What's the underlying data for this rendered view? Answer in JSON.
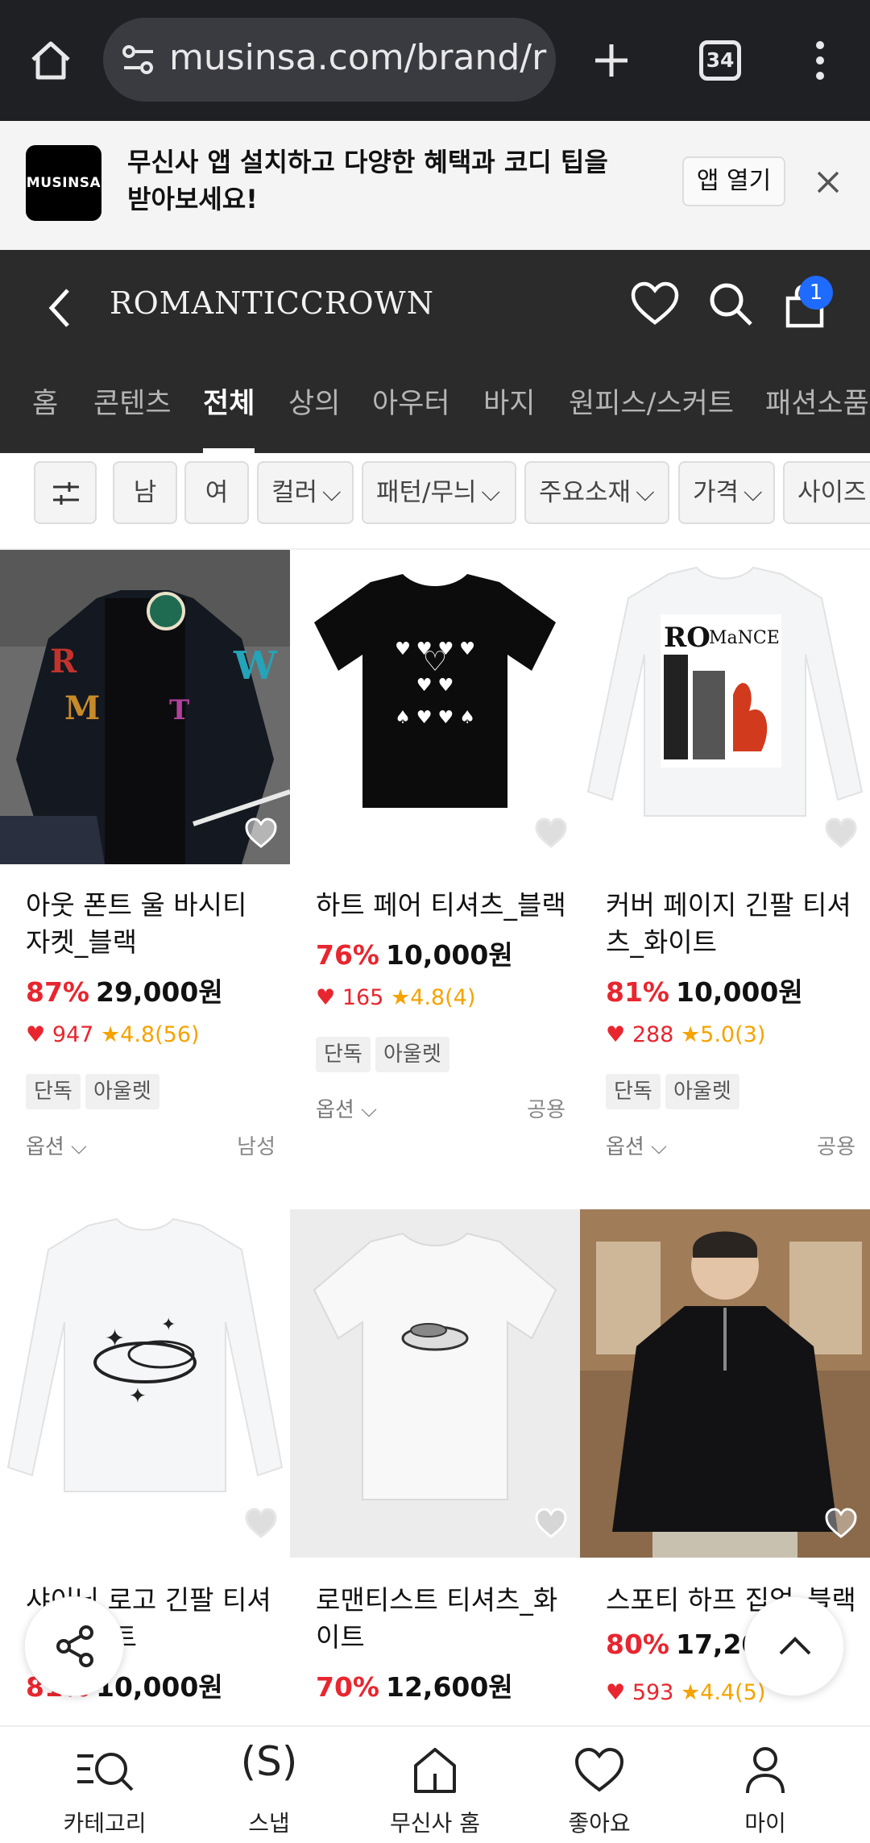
{
  "browser": {
    "url": "musinsa.com/brand/r",
    "tab_count": "34",
    "icons": [
      "home-icon",
      "site-settings-icon",
      "new-tab-icon",
      "tab-switcher-icon",
      "more-menu-icon"
    ]
  },
  "app_banner": {
    "logo_text": "MUSINSA",
    "message_line1": "무신사 앱 설치하고 다양한 혜택과 코디 팁을",
    "message_line2": "받아보세요!",
    "open_label": "앱 열기"
  },
  "brand_header": {
    "brand_name": "ROMANTICCROWN",
    "cart_count": "1",
    "tabs": [
      {
        "label": "홈"
      },
      {
        "label": "콘텐츠"
      },
      {
        "label": "전체",
        "active": true
      },
      {
        "label": "상의"
      },
      {
        "label": "아우터"
      },
      {
        "label": "바지"
      },
      {
        "label": "원피스/스커트"
      },
      {
        "label": "패션소품"
      }
    ]
  },
  "filters": {
    "chips": [
      "남",
      "여",
      "컬러",
      "패턴/무늬",
      "주요소재",
      "가격",
      "사이즈"
    ]
  },
  "products": [
    {
      "name": "아웃 폰트 울 바시티 자켓_블랙",
      "discount": "87%",
      "price": "29,000원",
      "likes": "947",
      "rating": "4.8(56)",
      "tags": [
        "단독",
        "아울렛"
      ],
      "option": "옵션",
      "gender": "남성"
    },
    {
      "name": "하트 페어 티셔츠_블랙",
      "discount": "76%",
      "price": "10,000원",
      "likes": "165",
      "rating": "4.8(4)",
      "tags": [
        "단독",
        "아울렛"
      ],
      "option": "옵션",
      "gender": "공용"
    },
    {
      "name": "커버 페이지 긴팔 티셔츠_화이트",
      "discount": "81%",
      "price": "10,000원",
      "likes": "288",
      "rating": "5.0(3)",
      "tags": [
        "단독",
        "아울렛"
      ],
      "option": "옵션",
      "gender": "공용"
    },
    {
      "name": "샤이닝 로고 긴팔 티셔츠_화이트",
      "discount": "81%",
      "price": "10,000원"
    },
    {
      "name": "로맨티스트 티셔츠_화이트",
      "discount": "70%",
      "price": "12,600원"
    },
    {
      "name": "스포티 하프 집업_블랙",
      "discount": "80%",
      "price": "17,200",
      "likes": "593",
      "rating": "4.4(5)"
    }
  ],
  "bottom_nav": [
    {
      "label": "카테고리",
      "icon": "category-search-icon"
    },
    {
      "label": "스냅",
      "icon": "snap-icon"
    },
    {
      "label": "무신사 홈",
      "icon": "home-icon"
    },
    {
      "label": "좋아요",
      "icon": "heart-icon"
    },
    {
      "label": "마이",
      "icon": "person-icon"
    }
  ],
  "colors": {
    "discount": "#e8262f",
    "rating": "#f5a300",
    "header_bg": "#2b2b2b",
    "badge": "#1f6bff"
  }
}
